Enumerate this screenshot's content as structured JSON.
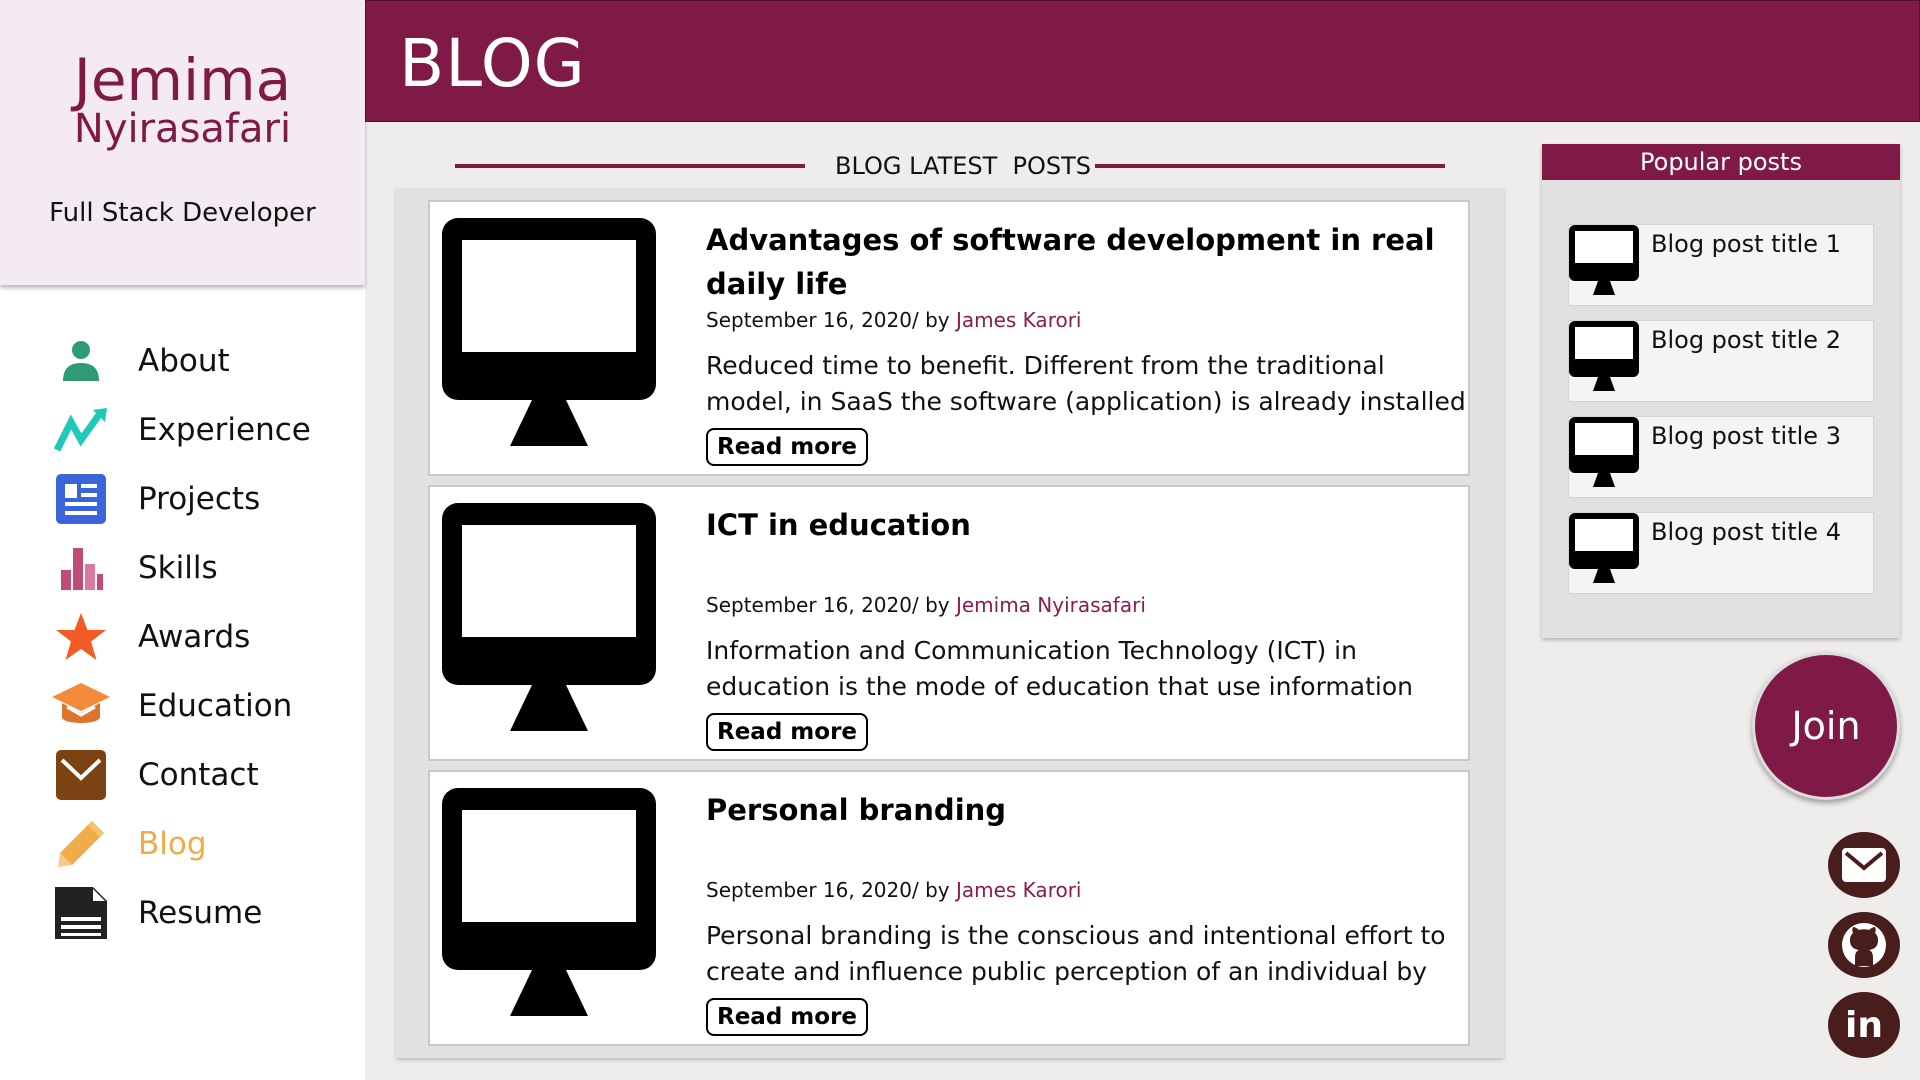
{
  "profile": {
    "first_name": "Jemima",
    "last_name": "Nyirasafari",
    "role": "Full Stack Developer"
  },
  "nav": {
    "items": [
      {
        "label": "About",
        "icon": "person-icon",
        "color": "#2e9a76"
      },
      {
        "label": "Experience",
        "icon": "trend-icon",
        "color": "#1ec9b8"
      },
      {
        "label": "Projects",
        "icon": "article-icon",
        "color": "#3a64d8"
      },
      {
        "label": "Skills",
        "icon": "bar-chart-icon",
        "color": "#c24a78"
      },
      {
        "label": "Awards",
        "icon": "star-icon",
        "color": "#f45a24"
      },
      {
        "label": "Education",
        "icon": "graduation-cap-icon",
        "color": "#f28c3c"
      },
      {
        "label": "Contact",
        "icon": "mail-icon",
        "color": "#7b4312"
      },
      {
        "label": "Blog",
        "icon": "pencil-icon",
        "color": "#f0ab4b",
        "active": true
      },
      {
        "label": "Resume",
        "icon": "document-icon",
        "color": "#222222"
      }
    ]
  },
  "header": {
    "title": "BLOG"
  },
  "latest": {
    "heading": "BLOG LATEST  POSTS",
    "posts": [
      {
        "title": "Advantages of software development in real daily life",
        "date": "September 16, 2020/ by ",
        "author": "James Karori",
        "excerpt": "Reduced time to benefit. Different from the traditional model, in SaaS the software (application) is already installed and",
        "read_more": "Read more"
      },
      {
        "title": "ICT in education",
        "date": "September 16, 2020/ by ",
        "author": "Jemima Nyirasafari",
        "excerpt": "Information and Communication Technology (ICT) in education is the mode of education that use information",
        "read_more": "Read more"
      },
      {
        "title": "Personal branding",
        "date": "September 16, 2020/ by ",
        "author": "James Karori",
        "excerpt": "Personal branding is the conscious and intentional effort to create and influence public perception of an individual by",
        "read_more": "Read more"
      }
    ]
  },
  "popular": {
    "heading": "Popular posts",
    "items": [
      {
        "label": "Blog post title 1"
      },
      {
        "label": "Blog post title 2"
      },
      {
        "label": "Blog post title 3"
      },
      {
        "label": "Blog post title 4"
      }
    ]
  },
  "join": {
    "label": "Join"
  },
  "social": [
    {
      "icon": "mail-icon",
      "label": "Email"
    },
    {
      "icon": "github-icon",
      "label": "GitHub"
    },
    {
      "icon": "linkedin-icon",
      "label": "in"
    }
  ],
  "colors": {
    "brand": "#7f1a47",
    "active_nav": "#f0ab4b",
    "author_link": "#8a1d4d"
  }
}
